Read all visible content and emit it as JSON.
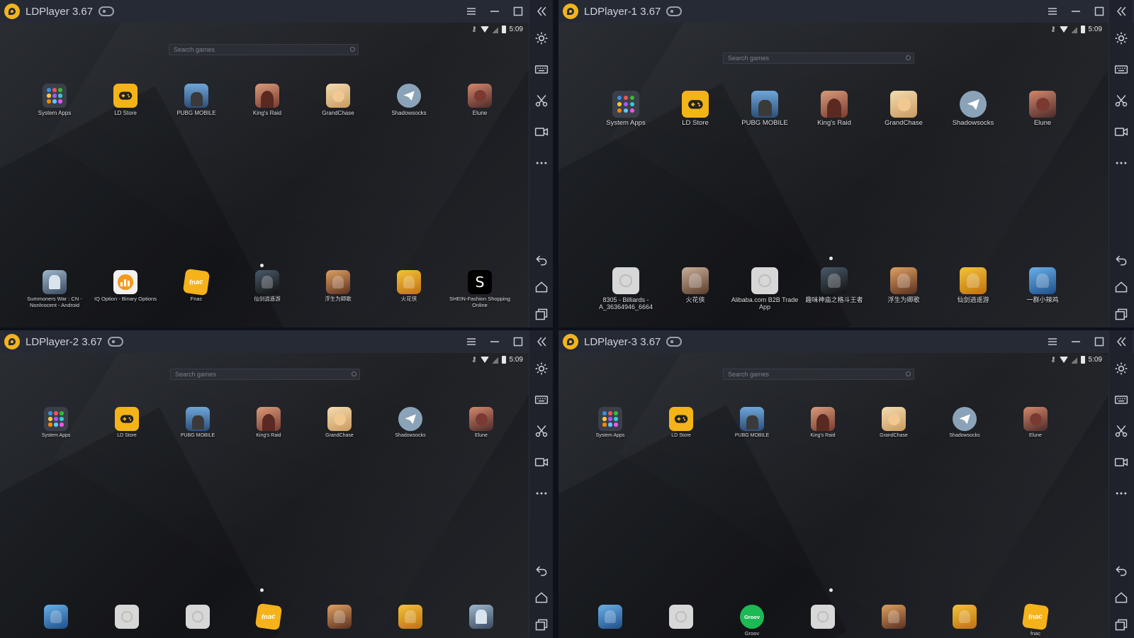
{
  "colors": {
    "accent": "#f2b41c",
    "titlebar": "#262a35",
    "sidebar": "#1f222b"
  },
  "windows": [
    {
      "title": "LDPlayer 3.67",
      "status_time": "5:09",
      "search_placeholder": "Search games",
      "top_apps": [
        {
          "label": "System Apps",
          "icon": "system-apps-icon"
        },
        {
          "label": "LD Store",
          "icon": "ld-store-icon"
        },
        {
          "label": "PUBG MOBILE",
          "icon": "pubg-icon"
        },
        {
          "label": "King's Raid",
          "icon": "kings-raid-icon"
        },
        {
          "label": "GrandChase",
          "icon": "grandchase-icon"
        },
        {
          "label": "Shadowsocks",
          "icon": "shadowsocks-icon"
        },
        {
          "label": "Elune",
          "icon": "elune-icon"
        }
      ],
      "dock_apps": [
        {
          "label": "Summoners War : CN - Nonlnocent - Android",
          "icon": "summoners-war-icon"
        },
        {
          "label": "IQ Option - Binary Options",
          "icon": "iq-option-icon"
        },
        {
          "label": "Fnac",
          "icon": "fnac-icon"
        },
        {
          "label": "仙剑逍遥游",
          "icon": "game-icon"
        },
        {
          "label": "浮生为卿歌",
          "icon": "game-icon"
        },
        {
          "label": "火花侠",
          "icon": "game-icon"
        },
        {
          "label": "SHEIN-Fashion Shopping Online",
          "icon": "shein-icon"
        }
      ]
    },
    {
      "title": "LDPlayer-1 3.67",
      "status_time": "5:09",
      "search_placeholder": "Search games",
      "top_apps": [
        {
          "label": "System Apps",
          "icon": "system-apps-icon"
        },
        {
          "label": "LD Store",
          "icon": "ld-store-icon"
        },
        {
          "label": "PUBG MOBILE",
          "icon": "pubg-icon"
        },
        {
          "label": "King's Raid",
          "icon": "kings-raid-icon"
        },
        {
          "label": "GrandChase",
          "icon": "grandchase-icon"
        },
        {
          "label": "Shadowsocks",
          "icon": "shadowsocks-icon"
        },
        {
          "label": "Elune",
          "icon": "elune-icon"
        }
      ],
      "dock_apps": [
        {
          "label": "8305 - Billiards - A_36364946_6664",
          "icon": "placeholder-app-icon"
        },
        {
          "label": "火花侠",
          "icon": "game-icon"
        },
        {
          "label": "Alibaba.com B2B Trade App",
          "icon": "placeholder-app-icon"
        },
        {
          "label": "趣味神庙之格斗王者",
          "icon": "game-icon"
        },
        {
          "label": "浮生为卿歌",
          "icon": "game-icon"
        },
        {
          "label": "仙剑逍遥游",
          "icon": "game-icon"
        },
        {
          "label": "一群小辣鸡",
          "icon": "game-icon"
        }
      ]
    },
    {
      "title": "LDPlayer-2 3.67",
      "status_time": "5:09",
      "search_placeholder": "Search games",
      "top_apps": [
        {
          "label": "System Apps",
          "icon": "system-apps-icon"
        },
        {
          "label": "LD Store",
          "icon": "ld-store-icon"
        },
        {
          "label": "PUBG MOBILE",
          "icon": "pubg-icon"
        },
        {
          "label": "King's Raid",
          "icon": "kings-raid-icon"
        },
        {
          "label": "GrandChase",
          "icon": "grandchase-icon"
        },
        {
          "label": "Shadowsocks",
          "icon": "shadowsocks-icon"
        },
        {
          "label": "Elune",
          "icon": "elune-icon"
        }
      ],
      "dock_apps": [
        {
          "label": "",
          "icon": "game-icon"
        },
        {
          "label": "",
          "icon": "placeholder-app-icon"
        },
        {
          "label": "",
          "icon": "placeholder-app-icon"
        },
        {
          "label": "",
          "icon": "fnac-icon"
        },
        {
          "label": "",
          "icon": "game-icon"
        },
        {
          "label": "",
          "icon": "game-icon"
        },
        {
          "label": "",
          "icon": "summoners-war-icon"
        }
      ]
    },
    {
      "title": "LDPlayer-3 3.67",
      "status_time": "5:09",
      "search_placeholder": "Search games",
      "top_apps": [
        {
          "label": "System Apps",
          "icon": "system-apps-icon"
        },
        {
          "label": "LD Store",
          "icon": "ld-store-icon"
        },
        {
          "label": "PUBG MOBILE",
          "icon": "pubg-icon"
        },
        {
          "label": "King's Raid",
          "icon": "kings-raid-icon"
        },
        {
          "label": "GrandChase",
          "icon": "grandchase-icon"
        },
        {
          "label": "Shadowsocks",
          "icon": "shadowsocks-icon"
        },
        {
          "label": "Elune",
          "icon": "elune-icon"
        }
      ],
      "dock_apps": [
        {
          "label": "",
          "icon": "game-icon"
        },
        {
          "label": "",
          "icon": "placeholder-app-icon"
        },
        {
          "label": "Groov",
          "icon": "groov-icon"
        },
        {
          "label": "",
          "icon": "placeholder-app-icon"
        },
        {
          "label": "",
          "icon": "game-icon"
        },
        {
          "label": "",
          "icon": "game-icon"
        },
        {
          "label": "fnac",
          "icon": "fnac-icon"
        }
      ]
    }
  ],
  "shein_letter": "S"
}
